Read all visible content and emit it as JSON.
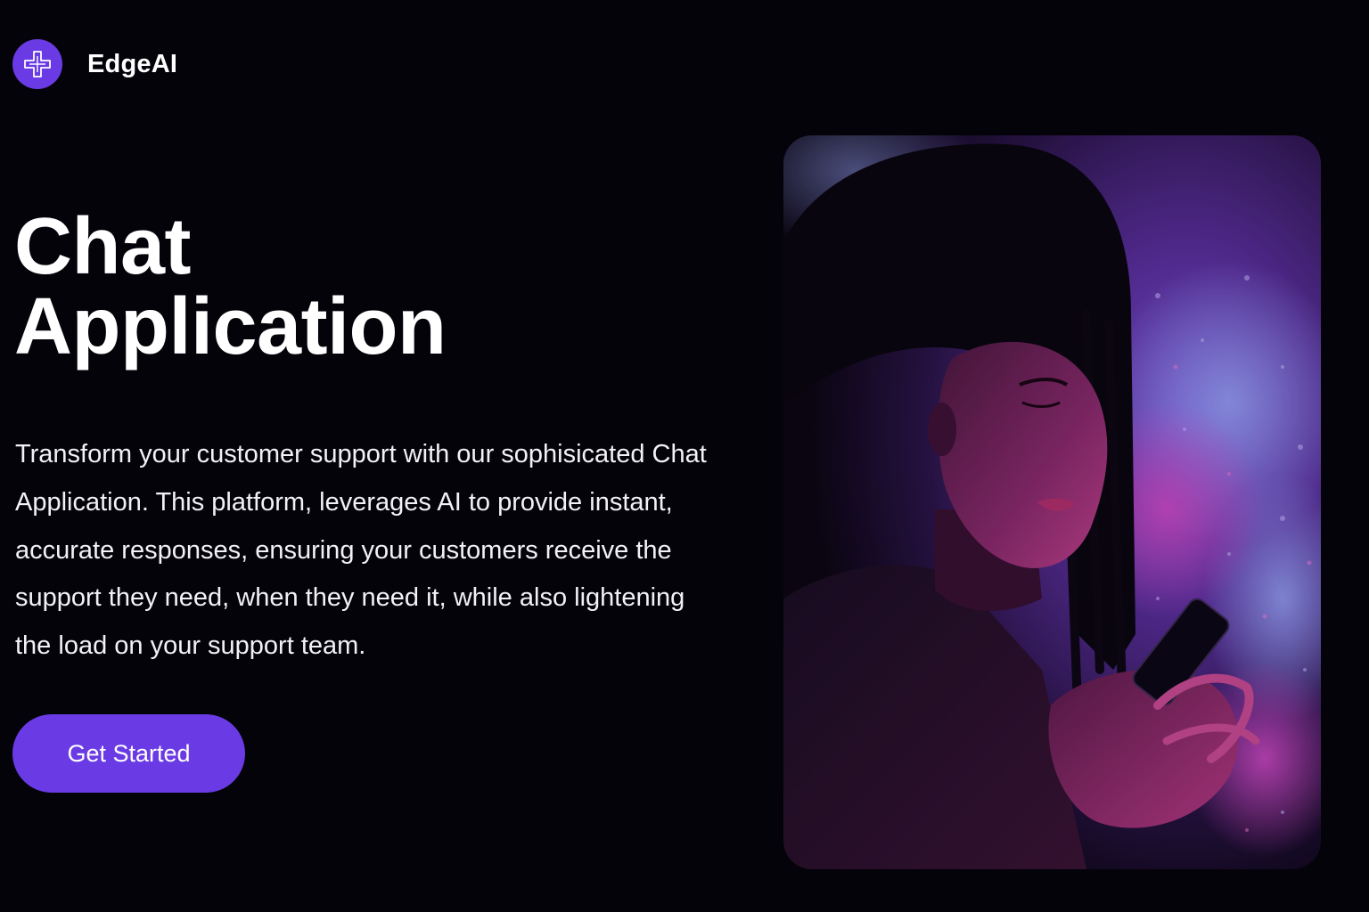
{
  "brand": {
    "name": "EdgeAI",
    "logo_icon": "cross-logo-icon",
    "accent_color": "#6a3be4"
  },
  "hero": {
    "title_line1": "Chat",
    "title_line2": "Application",
    "description": "Transform your customer support with our sophisicated Chat Application. This platform, leverages AI to provide instant, accurate responses, ensuring your customers receive the support they need, when they need it, while also lightening the load on your support team.",
    "cta_label": "Get Started",
    "image_alt": "Woman looking at a smartphone in purple light"
  }
}
